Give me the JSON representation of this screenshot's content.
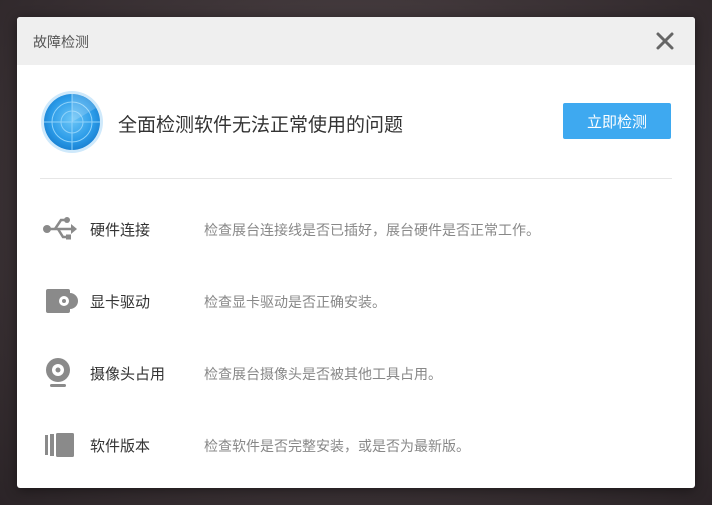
{
  "dialog": {
    "title": "故障检测",
    "close_icon": "close-icon"
  },
  "header": {
    "icon": "radar-icon",
    "headline": "全面检测软件无法正常使用的问题",
    "detect_button_label": "立即检测",
    "accent_color": "#3ea9f0"
  },
  "items": [
    {
      "icon": "usb-icon",
      "name": "硬件连接",
      "description": "检查展台连接线是否已插好，展台硬件是否正常工作。"
    },
    {
      "icon": "graphics-card-icon",
      "name": "显卡驱动",
      "description": "检查显卡驱动是否正确安装。"
    },
    {
      "icon": "webcam-icon",
      "name": "摄像头占用",
      "description": "检查展台摄像头是否被其他工具占用。"
    },
    {
      "icon": "software-version-icon",
      "name": "软件版本",
      "description": "检查软件是否完整安装，或是否为最新版。"
    }
  ]
}
